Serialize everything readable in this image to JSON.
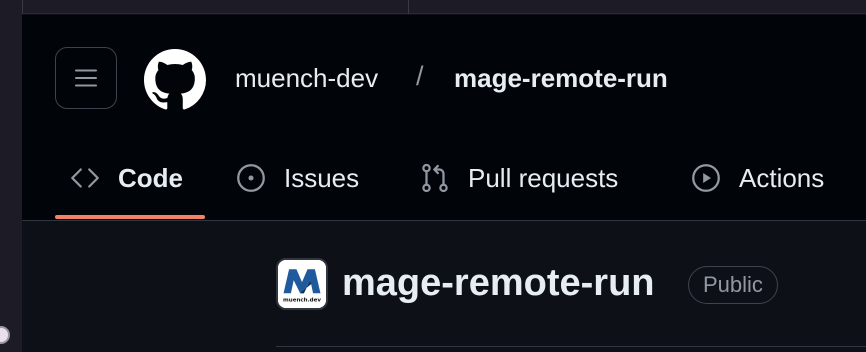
{
  "header": {
    "owner": "muench-dev",
    "separator": "/",
    "repo_name": "mage-remote-run"
  },
  "tabs": [
    {
      "label": "Code",
      "icon": "code-icon",
      "active": true
    },
    {
      "label": "Issues",
      "icon": "issue-opened-icon",
      "active": false
    },
    {
      "label": "Pull requests",
      "icon": "git-pull-request-icon",
      "active": false
    },
    {
      "label": "Actions",
      "icon": "play-icon",
      "active": false
    }
  ],
  "repo": {
    "title": "mage-remote-run",
    "visibility": "Public",
    "avatar_icon": "muench-dev-logo",
    "avatar_text": "muench.dev"
  },
  "colors": {
    "header_bg": "#010409",
    "page_bg": "#0d1117",
    "accent_underline": "#f78166",
    "text": "#e6edf3",
    "muted": "#9198a1",
    "border": "#30363d"
  }
}
